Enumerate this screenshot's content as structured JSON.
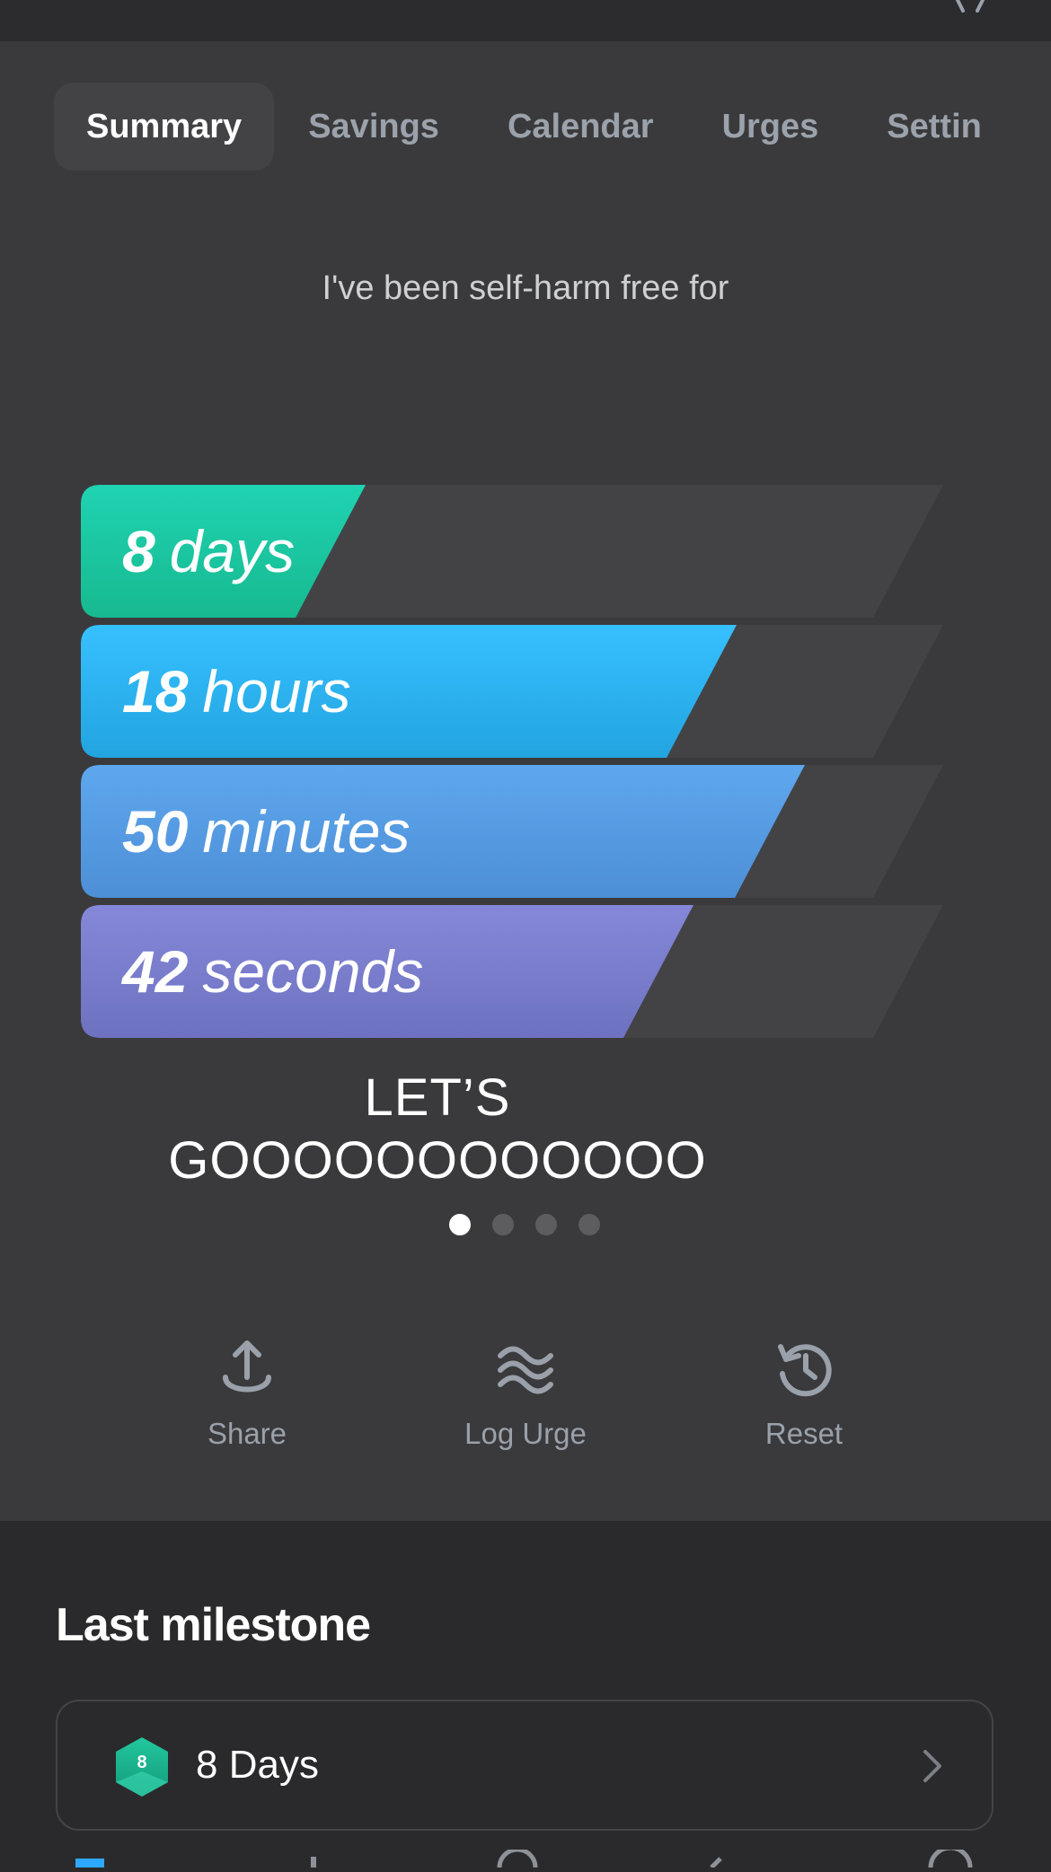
{
  "tabs": [
    {
      "label": "Summary",
      "active": true
    },
    {
      "label": "Savings"
    },
    {
      "label": "Calendar"
    },
    {
      "label": "Urges"
    },
    {
      "label": "Settin"
    }
  ],
  "summary": {
    "subtitle": "I've been self-harm free for",
    "counters": [
      {
        "value": "8",
        "unit": "days",
        "progress": 0.33,
        "color_start": "#1fd3b2",
        "color_end": "#17b98f"
      },
      {
        "value": "18",
        "unit": "hours",
        "progress": 0.76,
        "color_start": "#37c0ff",
        "color_end": "#22a4e0"
      },
      {
        "value": "50",
        "unit": "minutes",
        "progress": 0.84,
        "color_start": "#5ea7ee",
        "color_end": "#4d8fd6"
      },
      {
        "value": "42",
        "unit": "seconds",
        "progress": 0.71,
        "color_start": "#8588d8",
        "color_end": "#6d72c0"
      }
    ],
    "message_line1": "LET’S",
    "message_line2": "GOOOOOOOOOOOO",
    "pager": {
      "count": 4,
      "active": 0
    }
  },
  "actions": [
    {
      "label": "Share",
      "icon": "share-icon"
    },
    {
      "label": "Log Urge",
      "icon": "waves-icon"
    },
    {
      "label": "Reset",
      "icon": "history-icon"
    }
  ],
  "milestone": {
    "title": "Last milestone",
    "badge_number": "8",
    "label": "8 Days"
  },
  "colors": {
    "hero_bg": "#3a3a3c",
    "page_bg": "#2a2a2c",
    "bar_track": "#434345",
    "muted_text": "#9aa1aa"
  }
}
